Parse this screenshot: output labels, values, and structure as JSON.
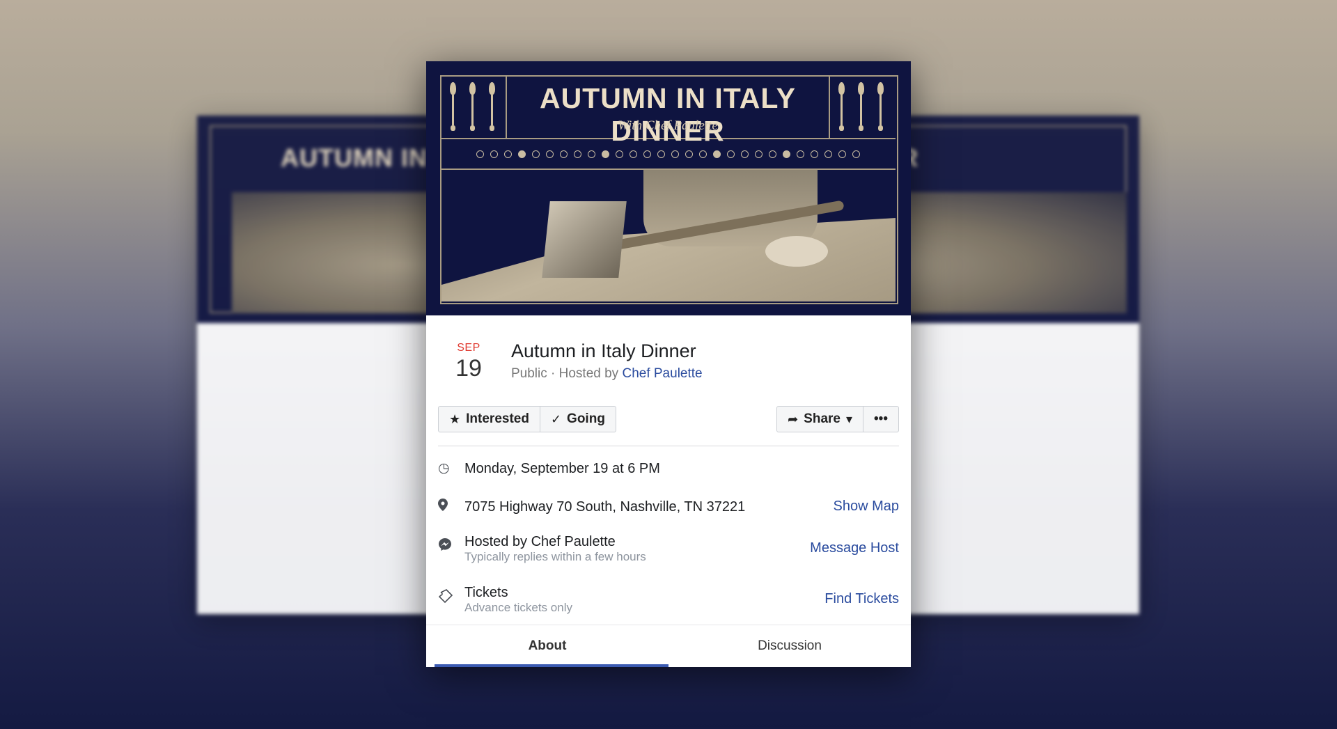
{
  "event": {
    "banner_title": "AUTUMN IN ITALY DINNER",
    "banner_subtitle": "With Chef Paulette",
    "month": "SEP",
    "day": "19",
    "title": "Autumn in Italy Dinner",
    "visibility": "Public · Hosted by",
    "host": "Chef Paulette"
  },
  "actions": {
    "interested": "Interested",
    "going": "Going",
    "share": "Share",
    "more": "•••"
  },
  "details": {
    "datetime": "Monday, September 19 at 6 PM",
    "address": "7075 Highway 70 South, Nashville, TN 37221",
    "show_map": "Show Map",
    "hosted_by": "Hosted by Chef Paulette",
    "reply_time": "Typically replies within a few hours",
    "message_host": "Message Host",
    "tickets": "Tickets",
    "tickets_sub": "Advance tickets only",
    "find_tickets": "Find Tickets"
  },
  "tabs": {
    "about": "About",
    "discussion": "Discussion"
  },
  "icons": {
    "star": "★",
    "check": "✓",
    "share_arrow": "➦",
    "caret": "▾",
    "clock": "◷",
    "pin": "⬤",
    "messenger": "💬",
    "ticket": "◇"
  },
  "colors": {
    "banner_bg": "#0f1440",
    "accent_blue": "#2a4b9e",
    "date_red": "#e0382e",
    "tab_underline": "#3b5bb2"
  }
}
